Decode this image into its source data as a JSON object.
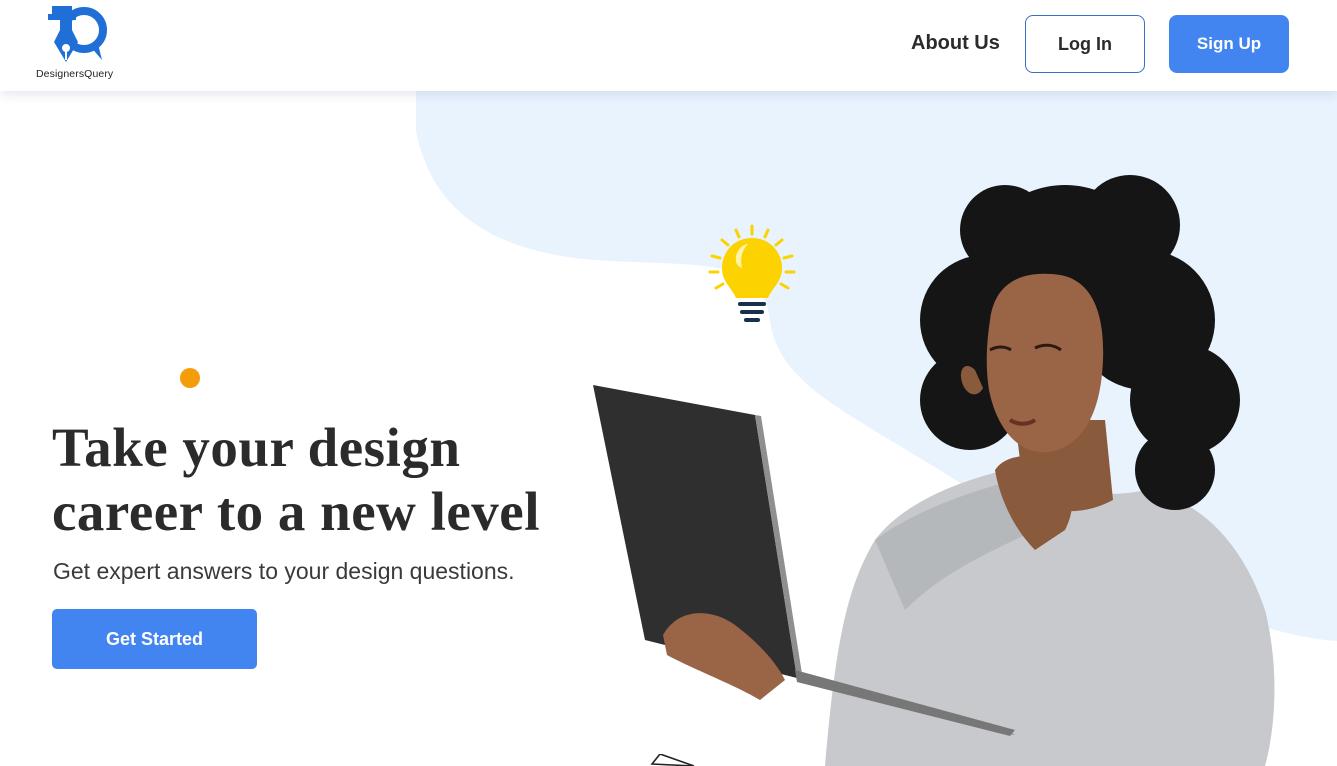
{
  "header": {
    "logo_text": "DesignersQuery",
    "nav_about": "About Us",
    "login_label": "Log In",
    "signup_label": "Sign Up"
  },
  "hero": {
    "headline": "Take your design career to a new level",
    "subtext": "Get expert answers to your design questions.",
    "cta_label": "Get Started",
    "image": "woman-with-laptop-illustration",
    "decoration_icons": [
      "lightbulb-icon",
      "paper-plane-icon"
    ]
  },
  "colors": {
    "accent": "#4285f0",
    "dot": "#f59c0b",
    "blob": "#e9f3fe",
    "logo": "#1f6fd6",
    "bulb": "#fcd200"
  }
}
